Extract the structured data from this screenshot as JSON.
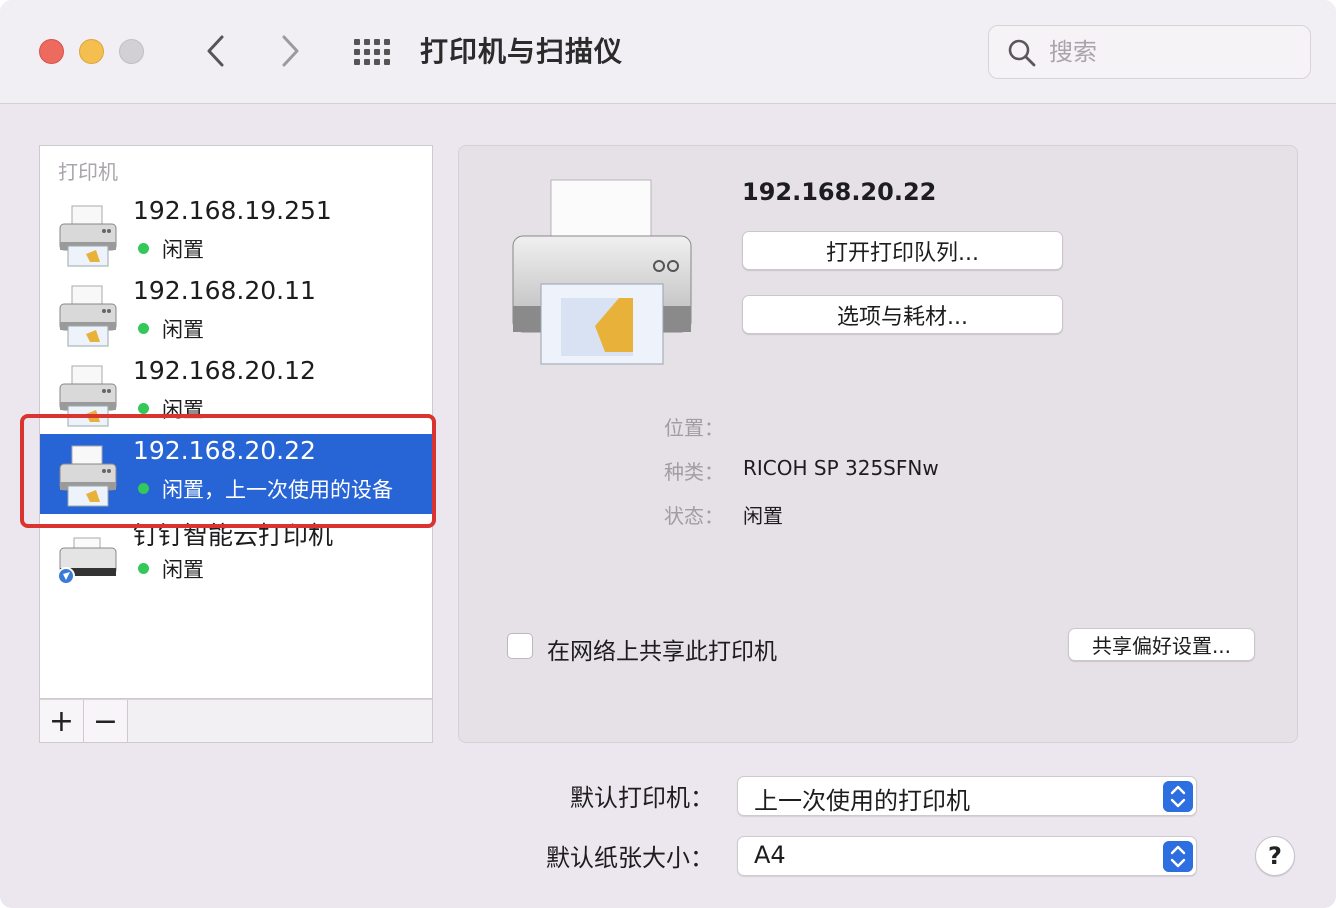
{
  "window": {
    "title": "打印机与扫描仪",
    "search_placeholder": "搜索"
  },
  "list": {
    "header": "打印机",
    "items": [
      {
        "name": "192.168.19.251",
        "status": "闲置",
        "selected": false
      },
      {
        "name": "192.168.20.11",
        "status": "闲置",
        "selected": false
      },
      {
        "name": "192.168.20.12",
        "status": "闲置",
        "selected": false
      },
      {
        "name": "192.168.20.22",
        "status": "闲置，上一次使用的设备",
        "selected": true
      },
      {
        "name": "钉钉智能云打印机",
        "status": "闲置",
        "selected": false
      }
    ],
    "add_label": "+",
    "remove_label": "−"
  },
  "detail": {
    "printer_name": "192.168.20.22",
    "open_queue_label": "打开打印队列...",
    "options_label": "选项与耗材...",
    "location_label": "位置：",
    "location_value": "",
    "kind_label": "种类：",
    "kind_value": "RICOH SP 325SFNw",
    "status_label": "状态：",
    "status_value": "闲置",
    "share_label": "在网络上共享此打印机",
    "share_checked": false,
    "share_prefs_label": "共享偏好设置..."
  },
  "defaults": {
    "printer_label": "默认打印机：",
    "printer_value": "上一次使用的打印机",
    "paper_label": "默认纸张大小：",
    "paper_value": "A4"
  },
  "help_label": "?",
  "icons": {
    "back": "chevron-left-icon",
    "forward": "chevron-right-icon",
    "grid": "grid-icon",
    "search": "search-icon",
    "printer": "printer-icon",
    "stepper": "up-down-chevron-icon"
  },
  "colors": {
    "selection": "#2764d6",
    "status_dot": "#34c759",
    "highlight": "#d9342f",
    "stepper": "#2d6ee0"
  }
}
